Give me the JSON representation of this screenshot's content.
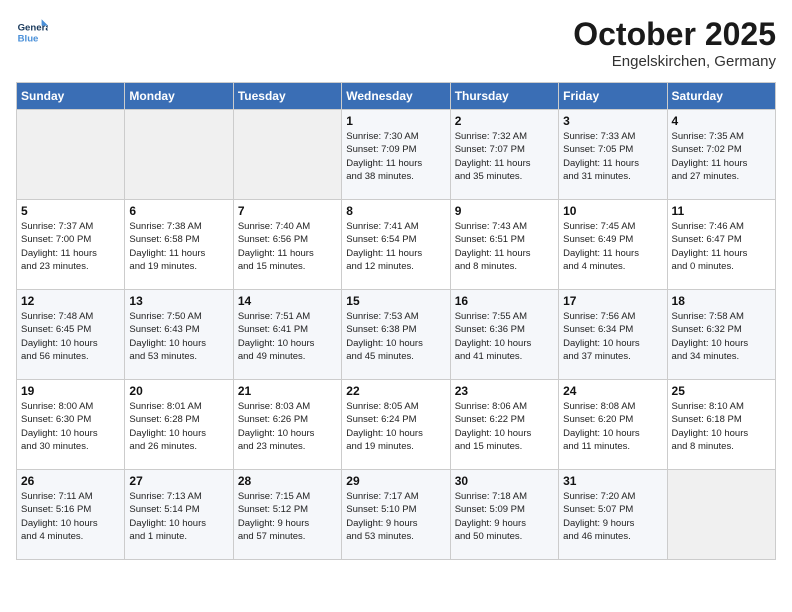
{
  "header": {
    "logo_line1": "General",
    "logo_line2": "Blue",
    "title": "October 2025",
    "subtitle": "Engelskirchen, Germany"
  },
  "days_of_week": [
    "Sunday",
    "Monday",
    "Tuesday",
    "Wednesday",
    "Thursday",
    "Friday",
    "Saturday"
  ],
  "weeks": [
    [
      {
        "num": "",
        "info": ""
      },
      {
        "num": "",
        "info": ""
      },
      {
        "num": "",
        "info": ""
      },
      {
        "num": "1",
        "info": "Sunrise: 7:30 AM\nSunset: 7:09 PM\nDaylight: 11 hours\nand 38 minutes."
      },
      {
        "num": "2",
        "info": "Sunrise: 7:32 AM\nSunset: 7:07 PM\nDaylight: 11 hours\nand 35 minutes."
      },
      {
        "num": "3",
        "info": "Sunrise: 7:33 AM\nSunset: 7:05 PM\nDaylight: 11 hours\nand 31 minutes."
      },
      {
        "num": "4",
        "info": "Sunrise: 7:35 AM\nSunset: 7:02 PM\nDaylight: 11 hours\nand 27 minutes."
      }
    ],
    [
      {
        "num": "5",
        "info": "Sunrise: 7:37 AM\nSunset: 7:00 PM\nDaylight: 11 hours\nand 23 minutes."
      },
      {
        "num": "6",
        "info": "Sunrise: 7:38 AM\nSunset: 6:58 PM\nDaylight: 11 hours\nand 19 minutes."
      },
      {
        "num": "7",
        "info": "Sunrise: 7:40 AM\nSunset: 6:56 PM\nDaylight: 11 hours\nand 15 minutes."
      },
      {
        "num": "8",
        "info": "Sunrise: 7:41 AM\nSunset: 6:54 PM\nDaylight: 11 hours\nand 12 minutes."
      },
      {
        "num": "9",
        "info": "Sunrise: 7:43 AM\nSunset: 6:51 PM\nDaylight: 11 hours\nand 8 minutes."
      },
      {
        "num": "10",
        "info": "Sunrise: 7:45 AM\nSunset: 6:49 PM\nDaylight: 11 hours\nand 4 minutes."
      },
      {
        "num": "11",
        "info": "Sunrise: 7:46 AM\nSunset: 6:47 PM\nDaylight: 11 hours\nand 0 minutes."
      }
    ],
    [
      {
        "num": "12",
        "info": "Sunrise: 7:48 AM\nSunset: 6:45 PM\nDaylight: 10 hours\nand 56 minutes."
      },
      {
        "num": "13",
        "info": "Sunrise: 7:50 AM\nSunset: 6:43 PM\nDaylight: 10 hours\nand 53 minutes."
      },
      {
        "num": "14",
        "info": "Sunrise: 7:51 AM\nSunset: 6:41 PM\nDaylight: 10 hours\nand 49 minutes."
      },
      {
        "num": "15",
        "info": "Sunrise: 7:53 AM\nSunset: 6:38 PM\nDaylight: 10 hours\nand 45 minutes."
      },
      {
        "num": "16",
        "info": "Sunrise: 7:55 AM\nSunset: 6:36 PM\nDaylight: 10 hours\nand 41 minutes."
      },
      {
        "num": "17",
        "info": "Sunrise: 7:56 AM\nSunset: 6:34 PM\nDaylight: 10 hours\nand 37 minutes."
      },
      {
        "num": "18",
        "info": "Sunrise: 7:58 AM\nSunset: 6:32 PM\nDaylight: 10 hours\nand 34 minutes."
      }
    ],
    [
      {
        "num": "19",
        "info": "Sunrise: 8:00 AM\nSunset: 6:30 PM\nDaylight: 10 hours\nand 30 minutes."
      },
      {
        "num": "20",
        "info": "Sunrise: 8:01 AM\nSunset: 6:28 PM\nDaylight: 10 hours\nand 26 minutes."
      },
      {
        "num": "21",
        "info": "Sunrise: 8:03 AM\nSunset: 6:26 PM\nDaylight: 10 hours\nand 23 minutes."
      },
      {
        "num": "22",
        "info": "Sunrise: 8:05 AM\nSunset: 6:24 PM\nDaylight: 10 hours\nand 19 minutes."
      },
      {
        "num": "23",
        "info": "Sunrise: 8:06 AM\nSunset: 6:22 PM\nDaylight: 10 hours\nand 15 minutes."
      },
      {
        "num": "24",
        "info": "Sunrise: 8:08 AM\nSunset: 6:20 PM\nDaylight: 10 hours\nand 11 minutes."
      },
      {
        "num": "25",
        "info": "Sunrise: 8:10 AM\nSunset: 6:18 PM\nDaylight: 10 hours\nand 8 minutes."
      }
    ],
    [
      {
        "num": "26",
        "info": "Sunrise: 7:11 AM\nSunset: 5:16 PM\nDaylight: 10 hours\nand 4 minutes."
      },
      {
        "num": "27",
        "info": "Sunrise: 7:13 AM\nSunset: 5:14 PM\nDaylight: 10 hours\nand 1 minute."
      },
      {
        "num": "28",
        "info": "Sunrise: 7:15 AM\nSunset: 5:12 PM\nDaylight: 9 hours\nand 57 minutes."
      },
      {
        "num": "29",
        "info": "Sunrise: 7:17 AM\nSunset: 5:10 PM\nDaylight: 9 hours\nand 53 minutes."
      },
      {
        "num": "30",
        "info": "Sunrise: 7:18 AM\nSunset: 5:09 PM\nDaylight: 9 hours\nand 50 minutes."
      },
      {
        "num": "31",
        "info": "Sunrise: 7:20 AM\nSunset: 5:07 PM\nDaylight: 9 hours\nand 46 minutes."
      },
      {
        "num": "",
        "info": ""
      }
    ]
  ]
}
